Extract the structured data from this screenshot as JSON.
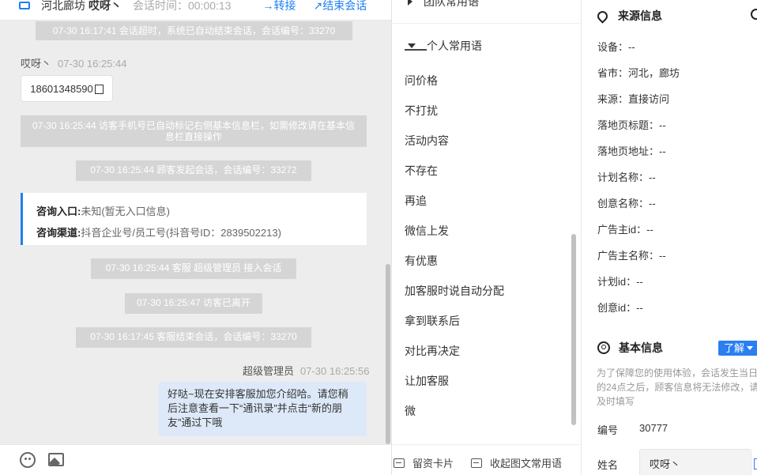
{
  "header": {
    "location": "河北廊坊",
    "nickname": "哎呀丶",
    "session_time": "会话时间：00:00:13",
    "transfer": "转接",
    "end": "结束会话"
  },
  "messages": {
    "sys_timeout": "07-30 16:17:41 会话超时，系统已自动结束会话，会话编号：33270",
    "visitor_name": "哎呀丶",
    "visitor_time": "07-30 16:25:44",
    "phone": "18601348590",
    "sys_phone": "07-30 16:25:44 访客手机号已自动标记右侧基本信息栏，如需修改请在基本信息栏直接操作",
    "sys_start": "07-30 16:25:44 顾客发起会话，会话编号：33272",
    "consult_entry_label": "咨询入口:",
    "consult_entry_value": "未知(暂无入口信息)",
    "consult_channel_label": "咨询渠道:",
    "consult_channel_value": "抖音企业号/员工号(抖音号ID：2839502213)",
    "sys_join": "07-30 16:25:44 客服 超级管理员 接入会话",
    "sys_leave": "07-30 16:25:47 访客已离开",
    "sys_end": "07-30 16:17:45 客服结束会话，会话编号：33270",
    "agent_name": "超级管理员",
    "agent_time": "07-30 16:25:56",
    "agent_text": "好哒~现在安排客服加您介绍哈。请您稍后注意查看一下“通讯录”并点击“新的朋友”通过下哦"
  },
  "phrases": {
    "team_group": "团队常用语",
    "personal_group": "个人常用语",
    "items": [
      "问价格",
      "不打扰",
      "活动内容",
      "不存在",
      "再追",
      "微信上发",
      "有优惠",
      "加客服时说自动分配",
      "拿到联系后",
      "对比再决定",
      "让加客服",
      "微"
    ],
    "card_button": "留资卡片",
    "collapse_button": "收起图文常用语"
  },
  "info": {
    "source_title": "来源信息",
    "device": "设备：--",
    "province": "省市：河北，廊坊",
    "source": "来源：直接访问",
    "landing_title": "落地页标题：--",
    "landing_url": "落地页地址：--",
    "plan_name": "计划名称：--",
    "creative_name": "创意名称：--",
    "advertiser_id": "广告主id：--",
    "advertiser_name": "广告主名称：--",
    "plan_id": "计划id：--",
    "creative_id": "创意id：--",
    "basic_title": "基本信息",
    "learn_more": "了解",
    "note": "为了保障您的使用体验，会话发生当日的24点之后，顾客信息将无法修改，请及时填写",
    "number_label": "编号",
    "number_value": "30777",
    "name_label": "姓名",
    "name_value": "哎呀丶"
  },
  "colors": {
    "accent": "#1e7ff0",
    "bubble": "#dde9f8",
    "system_chip": "#d5d5d5"
  }
}
